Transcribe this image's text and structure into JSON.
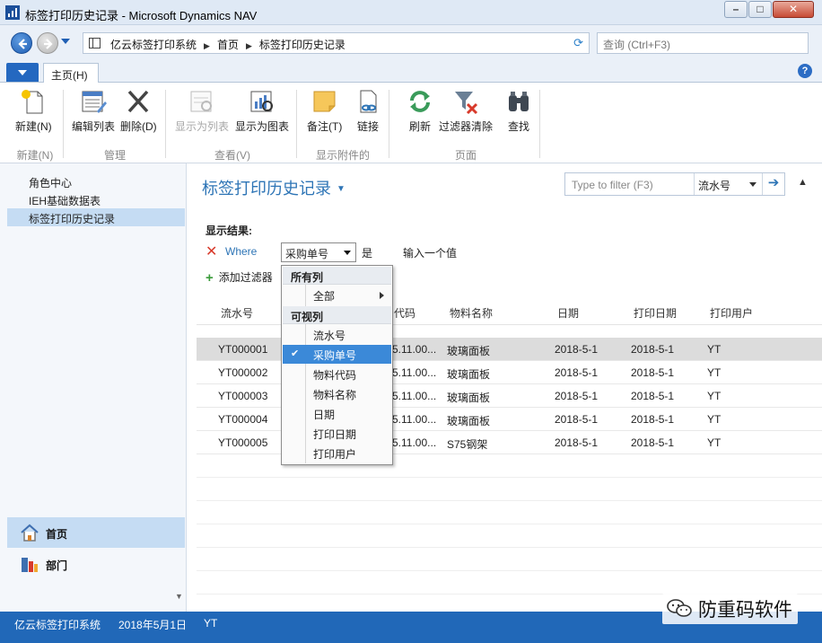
{
  "window": {
    "title": "标签打印历史记录 - Microsoft Dynamics NAV"
  },
  "address": {
    "crumbs": [
      "亿云标签打印系统",
      "首页",
      "标签打印历史记录"
    ],
    "search_placeholder": "查询 (Ctrl+F3)"
  },
  "ribbon": {
    "tab_home": "主页(H)",
    "buttons": {
      "new": "新建(N)",
      "edit_list": "编辑列表",
      "delete": "删除(D)",
      "show_as_list": "显示为列表",
      "show_as_chart": "显示为图表",
      "notes": "备注(T)",
      "links": "链接",
      "refresh": "刷新",
      "clear_filter": "过滤器清除",
      "find": "查找"
    },
    "groups": {
      "new": "新建(N)",
      "manage": "管理",
      "view": "查看(V)",
      "attachments": "显示附件的",
      "page": "页面"
    }
  },
  "leftnav": {
    "links": [
      "角色中心",
      "IEH基础数据表",
      "标签打印历史记录"
    ],
    "active_index": 2,
    "sections": [
      {
        "label": "首页",
        "icon": "home-icon"
      },
      {
        "label": "部门",
        "icon": "departments-icon"
      }
    ]
  },
  "page": {
    "title": "标签打印历史记录",
    "filter_placeholder": "Type to filter (F3)",
    "filter_column": "流水号"
  },
  "filter": {
    "show_results": "显示结果:",
    "where": "Where",
    "field": "采购单号",
    "is": "是",
    "value_placeholder": "输入一个值",
    "add_filter": "添加过滤器"
  },
  "dropdown": {
    "all_columns_header": "所有列",
    "all_item": "全部",
    "visible_header": "可视列",
    "visible_items": [
      "流水号",
      "采购单号",
      "物料代码",
      "物料名称",
      "日期",
      "打印日期",
      "打印用户"
    ],
    "selected_index": 1
  },
  "table": {
    "columns": [
      "流水号",
      "代码",
      "物料名称",
      "日期",
      "打印日期",
      "打印用户"
    ],
    "rows": [
      [
        "YT000001",
        "5.11.00...",
        "玻璃面板",
        "2018-5-1",
        "2018-5-1",
        "YT"
      ],
      [
        "YT000002",
        "5.11.00...",
        "玻璃面板",
        "2018-5-1",
        "2018-5-1",
        "YT"
      ],
      [
        "YT000003",
        "5.11.00...",
        "玻璃面板",
        "2018-5-1",
        "2018-5-1",
        "YT"
      ],
      [
        "YT000004",
        "5.11.00...",
        "玻璃面板",
        "2018-5-1",
        "2018-5-1",
        "YT"
      ],
      [
        "YT000005",
        "5.11.00...",
        "S75钢架",
        "2018-5-1",
        "2018-5-1",
        "YT"
      ]
    ],
    "selected_row": 0
  },
  "status": {
    "company": "亿云标签打印系统",
    "date": "2018年5月1日",
    "user": "YT"
  },
  "watermark": {
    "text": "防重码软件"
  },
  "colors": {
    "accent": "#2168b8",
    "title_blue": "#2e75b6",
    "selection": "#3b89d8",
    "row_selected": "#dcdcdc"
  }
}
